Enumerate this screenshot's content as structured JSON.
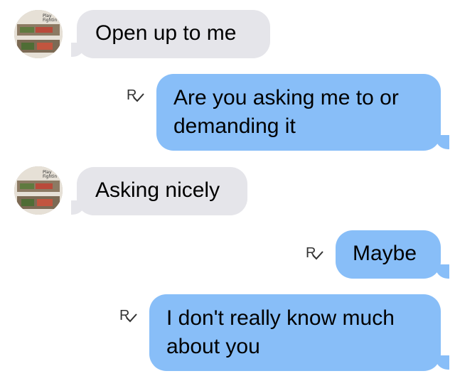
{
  "messages": [
    {
      "direction": "incoming",
      "text": "Open up to me"
    },
    {
      "direction": "outgoing",
      "text": "Are you asking me to or demanding it",
      "receipt": "R"
    },
    {
      "direction": "incoming",
      "text": "Asking nicely"
    },
    {
      "direction": "outgoing",
      "text": "Maybe",
      "receipt": "R"
    },
    {
      "direction": "outgoing",
      "text": "I don't really know much about you",
      "receipt": "R"
    }
  ],
  "avatar": {
    "caption_line1": "Play",
    "caption_line2": "Fightin"
  },
  "colors": {
    "incoming_bubble": "#e5e5ea",
    "outgoing_bubble": "#88bef8",
    "background": "#ffffff"
  },
  "icons": {
    "avatar": "contact-avatar-icon",
    "receipt": "read-receipt-icon"
  }
}
